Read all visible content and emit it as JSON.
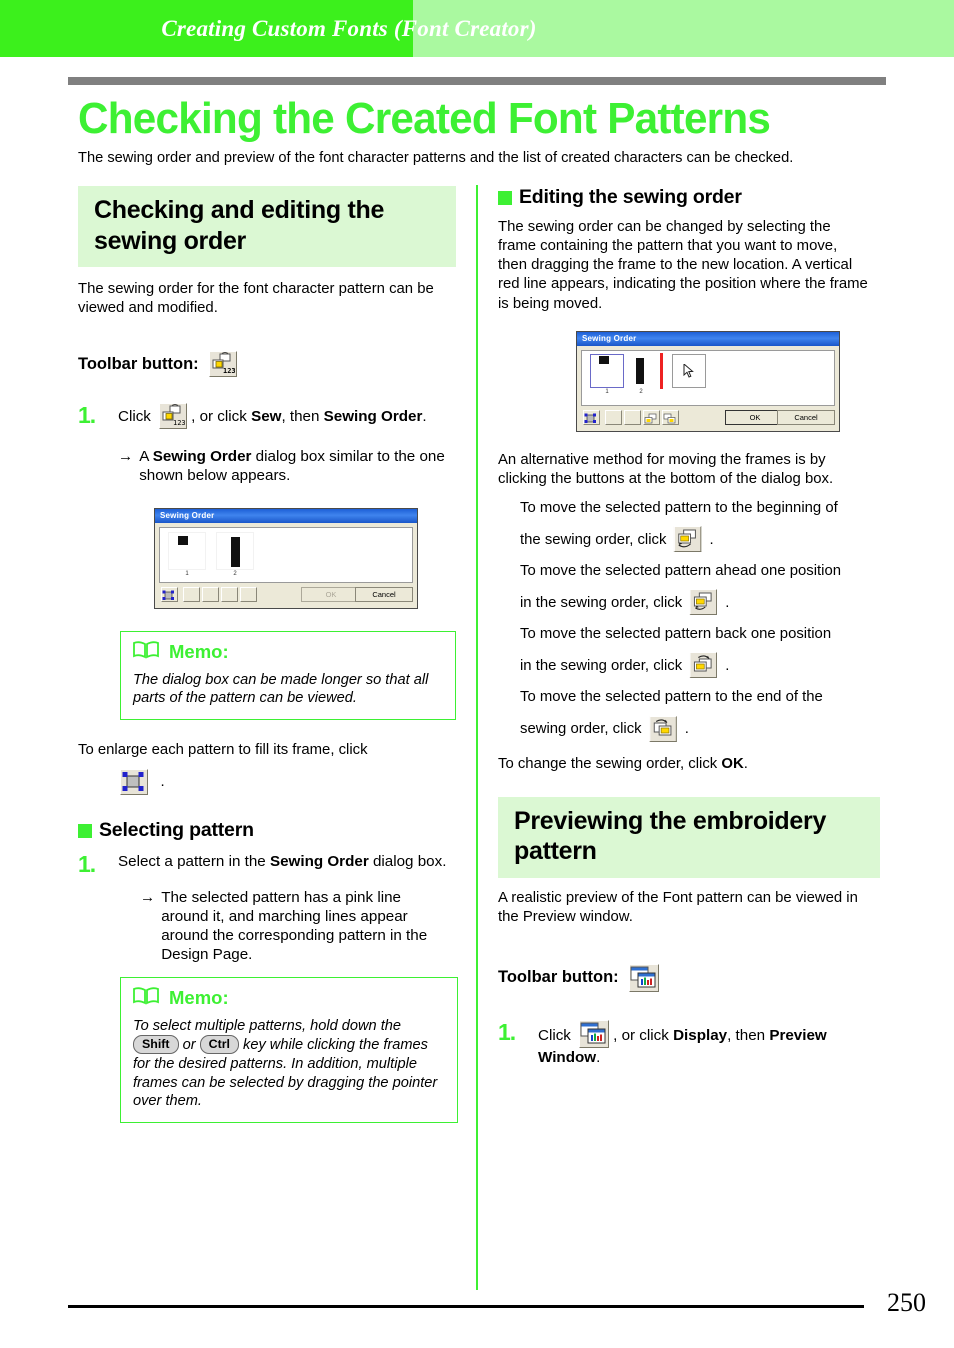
{
  "header": {
    "running_title": "Creating Custom Fonts (Font Creator)",
    "accent_color": "#3CF01C",
    "band_color": "#AAF9A0"
  },
  "page": {
    "title": "Checking the Created Font Patterns",
    "title_color": "#3DF033",
    "intro": "The sewing order and preview of the font character patterns and the list of created characters can be checked.",
    "number": "250"
  },
  "left_column": {
    "section_heading": "Checking and editing the sewing order",
    "section_intro": "The sewing order for the font character pattern can be viewed and modified.",
    "toolbar_label": "Toolbar button:",
    "toolbar_icon": "sewing-order-icon",
    "step1": {
      "number": "1.",
      "text_click": "Click",
      "text_rest_a": ", or click ",
      "bold_sew": "Sew",
      "text_rest_b": ", then ",
      "bold_sewing_order": "Sewing Order",
      "text_rest_c": "."
    },
    "arrow_note": {
      "arrow": "→",
      "text_a": "A ",
      "bold": "Sewing Order",
      "text_b": " dialog box similar to the one shown below appears."
    },
    "dialog": {
      "title": "Sewing Order",
      "frame_labels": [
        "1",
        "2"
      ],
      "ok_label": "OK",
      "cancel_label": "Cancel"
    },
    "memo1": {
      "title": "Memo:",
      "body": "The dialog box can be made longer so that all parts of the pattern can be viewed."
    },
    "enlarge_text": "To enlarge each pattern to fill its frame, click",
    "enlarge_icon": "zoom-to-fit-icon",
    "enlarge_period": ".",
    "selecting_pattern": {
      "heading": "Selecting pattern",
      "step_number": "1.",
      "text_a": "Select a pattern in the ",
      "bold": "Sewing Order",
      "text_b": " dialog box.",
      "arrow": "→",
      "arrow_text": "The selected pattern has a pink line around it, and marching lines appear around the corresponding pattern in the Design Page."
    },
    "memo2": {
      "title": "Memo:",
      "body_a": "To select multiple patterns, hold down the",
      "key1": "Shift",
      "or_text": "or",
      "key2": "Ctrl",
      "body_b": "key while clicking the frames for the desired patterns. In addition, multiple frames can be selected by dragging the pointer over them."
    }
  },
  "right_column": {
    "editing_heading": "Editing the sewing order",
    "editing_body": "The sewing order can be changed by selecting the frame containing the pattern that you want to move, then dragging the frame to the new location. A vertical red line appears, indicating the position where the frame is being moved.",
    "dialog": {
      "title": "Sewing Order",
      "frame_labels": [
        "1",
        "2"
      ],
      "ok_label": "OK",
      "cancel_label": "Cancel",
      "drop_marker_color": "#EE2222",
      "selection_color": "#6A6AC8"
    },
    "alt_method": "An alternative method for moving the frames is by clicking the buttons at the bottom of the dialog box.",
    "moves": [
      {
        "text_a": "To move the selected pattern to the beginning of",
        "text_b": "the sewing order, click",
        "icon": "move-to-beginning-icon",
        "period": "."
      },
      {
        "text_a": "To move the selected pattern ahead one position",
        "text_b": "in the sewing order, click",
        "icon": "move-ahead-icon",
        "period": "."
      },
      {
        "text_a": "To move the selected pattern back one position",
        "text_b": "in the sewing order, click",
        "icon": "move-back-icon",
        "period": "."
      },
      {
        "text_a": "To move the selected pattern to the end of the",
        "text_b": "sewing order, click",
        "icon": "move-to-end-icon",
        "period": "."
      }
    ],
    "change_order": {
      "text_a": "To change the sewing order, click ",
      "bold": "OK",
      "text_b": "."
    },
    "preview_heading": "Previewing the embroidery pattern",
    "preview_intro": "A realistic preview of the Font pattern can be viewed in the Preview window.",
    "toolbar_label": "Toolbar button:",
    "toolbar_icon": "preview-window-icon",
    "step1": {
      "number": "1.",
      "text_click": "Click",
      "text_rest_a": ", or click ",
      "bold_display": "Display",
      "text_rest_b": ", then ",
      "bold_preview_window": "Preview Window",
      "text_rest_c": "."
    }
  }
}
